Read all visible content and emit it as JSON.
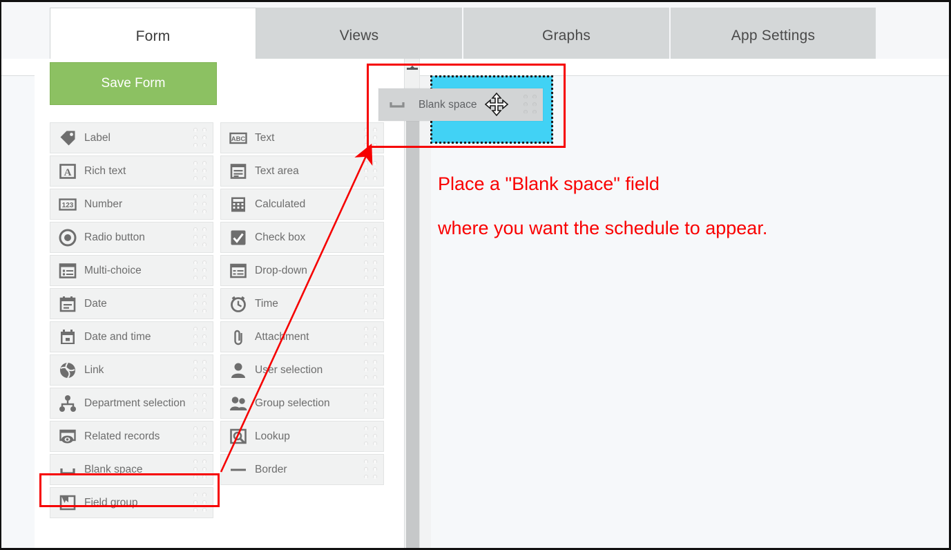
{
  "tabs": [
    {
      "label": "Form",
      "name": "tab-form",
      "active": true
    },
    {
      "label": "Views",
      "name": "tab-views",
      "active": false
    },
    {
      "label": "Graphs",
      "name": "tab-graphs",
      "active": false
    },
    {
      "label": "App Settings",
      "name": "tab-appsettings",
      "active": false
    }
  ],
  "toolbar": {
    "save_label": "Save Form",
    "save_color": "#8cc162"
  },
  "palette": {
    "left_column": [
      {
        "label": "Label",
        "icon": "tag-icon"
      },
      {
        "label": "Rich text",
        "icon": "rich-text-icon"
      },
      {
        "label": "Number",
        "icon": "number-123-icon"
      },
      {
        "label": "Radio button",
        "icon": "radio-button-icon"
      },
      {
        "label": "Multi-choice",
        "icon": "multi-choice-icon"
      },
      {
        "label": "Date",
        "icon": "calendar-icon"
      },
      {
        "label": "Date and time",
        "icon": "calendar-clock-icon"
      },
      {
        "label": "Link",
        "icon": "globe-icon"
      },
      {
        "label": "Department selection",
        "icon": "org-chart-icon"
      },
      {
        "label": "Related records",
        "icon": "related-records-icon"
      },
      {
        "label": "Blank space",
        "icon": "blank-space-icon"
      },
      {
        "label": "Field group",
        "icon": "field-group-icon"
      }
    ],
    "right_column": [
      {
        "label": "Text",
        "icon": "abc-icon"
      },
      {
        "label": "Text area",
        "icon": "text-area-icon"
      },
      {
        "label": "Calculated",
        "icon": "calculator-icon"
      },
      {
        "label": "Check box",
        "icon": "check-box-icon"
      },
      {
        "label": "Drop-down",
        "icon": "drop-down-icon"
      },
      {
        "label": "Time",
        "icon": "alarm-clock-icon"
      },
      {
        "label": "Attachment",
        "icon": "paperclip-icon"
      },
      {
        "label": "User selection",
        "icon": "user-icon"
      },
      {
        "label": "Group selection",
        "icon": "users-group-icon"
      },
      {
        "label": "Lookup",
        "icon": "magnifier-box-icon"
      },
      {
        "label": "Border",
        "icon": "horizontal-rule-icon"
      }
    ]
  },
  "drag": {
    "ghost_label": "Blank space",
    "ghost_icon": "blank-space-icon",
    "cursor_icon": "move-4way-cursor-icon",
    "drop_zone_color": "#41d2f5"
  },
  "annotation": {
    "highlight_color": "#f60000",
    "lines": [
      "Place a \"Blank space\" field",
      "where you want the schedule to appear."
    ]
  }
}
